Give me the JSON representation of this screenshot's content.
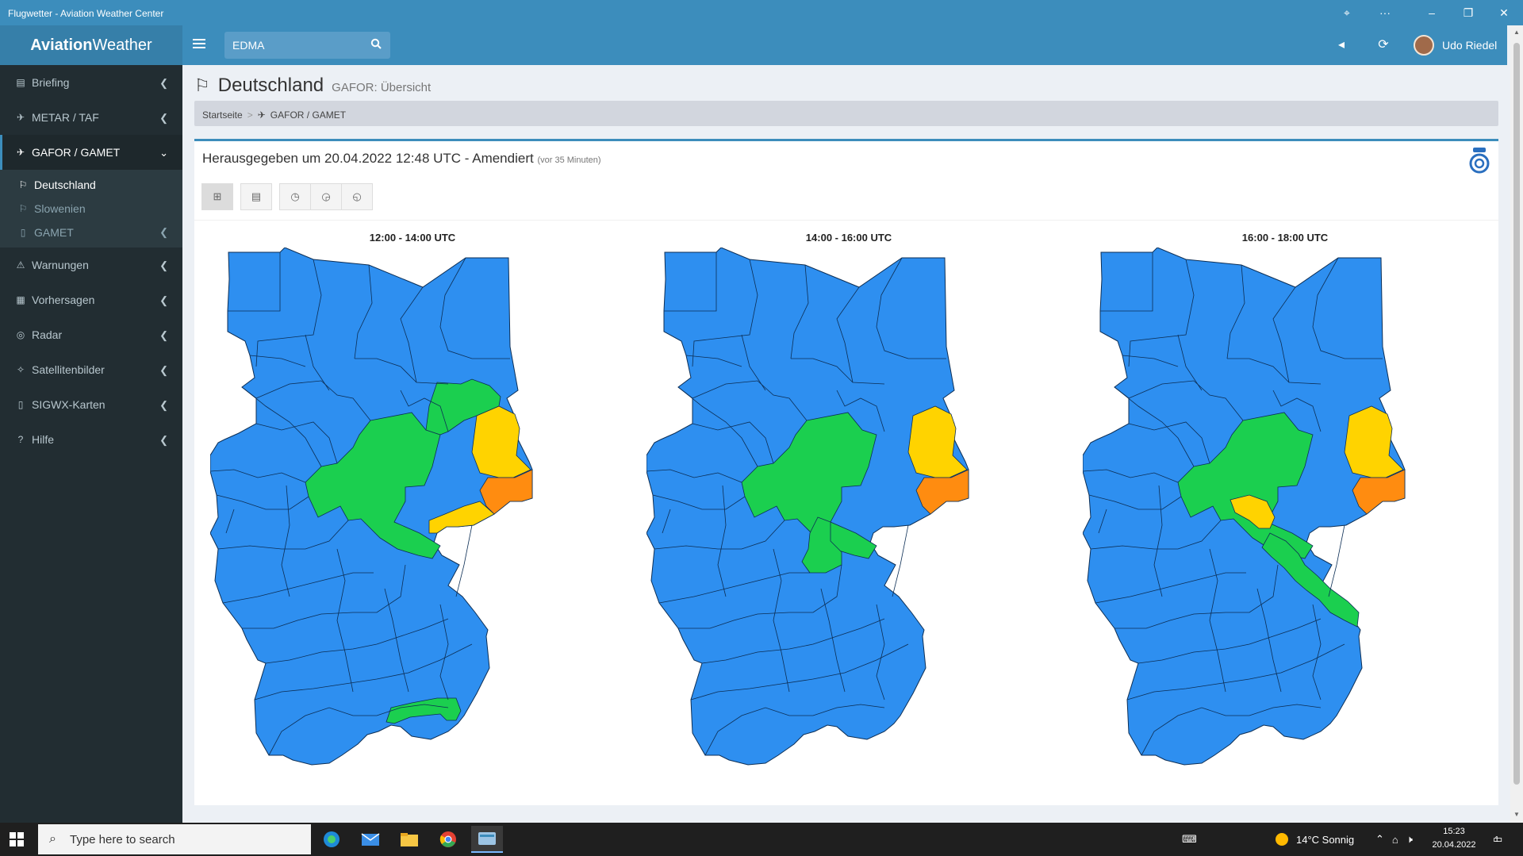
{
  "window": {
    "title": "Flugwetter - Aviation Weather Center"
  },
  "header": {
    "logo_bold": "Aviation",
    "logo_rest": "Weather",
    "search_value": "EDMA",
    "user_name": "Udo Riedel"
  },
  "sidebar": {
    "items": [
      {
        "label": "Briefing",
        "icon": "briefcase-icon"
      },
      {
        "label": "METAR / TAF",
        "icon": "plane-icon"
      },
      {
        "label": "GAFOR / GAMET",
        "icon": "plane-icon"
      },
      {
        "label": "Warnungen",
        "icon": "warning-icon"
      },
      {
        "label": "Vorhersagen",
        "icon": "calendar-icon"
      },
      {
        "label": "Radar",
        "icon": "radar-icon"
      },
      {
        "label": "Satellitenbilder",
        "icon": "satellite-icon"
      },
      {
        "label": "SIGWX-Karten",
        "icon": "map-icon"
      },
      {
        "label": "Hilfe",
        "icon": "help-icon"
      }
    ],
    "sub": [
      {
        "label": "Deutschland"
      },
      {
        "label": "Slowenien"
      },
      {
        "label": "GAMET"
      }
    ]
  },
  "page": {
    "title": "Deutschland",
    "subtitle": "GAFOR: Übersicht",
    "breadcrumb": [
      "Startseite",
      "GAFOR / GAMET"
    ],
    "issued": "Herausgegeben um 20.04.2022 12:48 UTC - Amendiert",
    "issued_note": "(vor 35 Minuten)"
  },
  "colors": {
    "O": "#2e8ff0",
    "D": "#1bcf4f",
    "M": "#ffd300",
    "X": "#ff8c10",
    "accent": "#3c8dbc"
  },
  "panels": [
    {
      "time": "12:00 - 14:00 UTC",
      "areas": [
        {
          "cat": "D",
          "shape": "center"
        },
        {
          "cat": "D",
          "shape": "north-east"
        },
        {
          "cat": "M",
          "shape": "east"
        },
        {
          "cat": "X",
          "shape": "south-east"
        },
        {
          "cat": "M",
          "shape": "east-strip"
        },
        {
          "cat": "D",
          "shape": "alps"
        }
      ]
    },
    {
      "time": "14:00 - 16:00 UTC",
      "areas": [
        {
          "cat": "D",
          "shape": "center"
        },
        {
          "cat": "D",
          "shape": "south"
        },
        {
          "cat": "M",
          "shape": "east"
        },
        {
          "cat": "X",
          "shape": "south-east"
        }
      ]
    },
    {
      "time": "16:00 - 18:00 UTC",
      "areas": [
        {
          "cat": "D",
          "shape": "center"
        },
        {
          "cat": "D",
          "shape": "south-east-strip"
        },
        {
          "cat": "M",
          "shape": "east"
        },
        {
          "cat": "X",
          "shape": "south-east"
        },
        {
          "cat": "M",
          "shape": "center-small"
        }
      ]
    }
  ],
  "taskbar": {
    "search_placeholder": "Type here to search",
    "weather": "14°C  Sonnig",
    "time": "15:23",
    "date": "20.04.2022",
    "notifications": "1"
  }
}
